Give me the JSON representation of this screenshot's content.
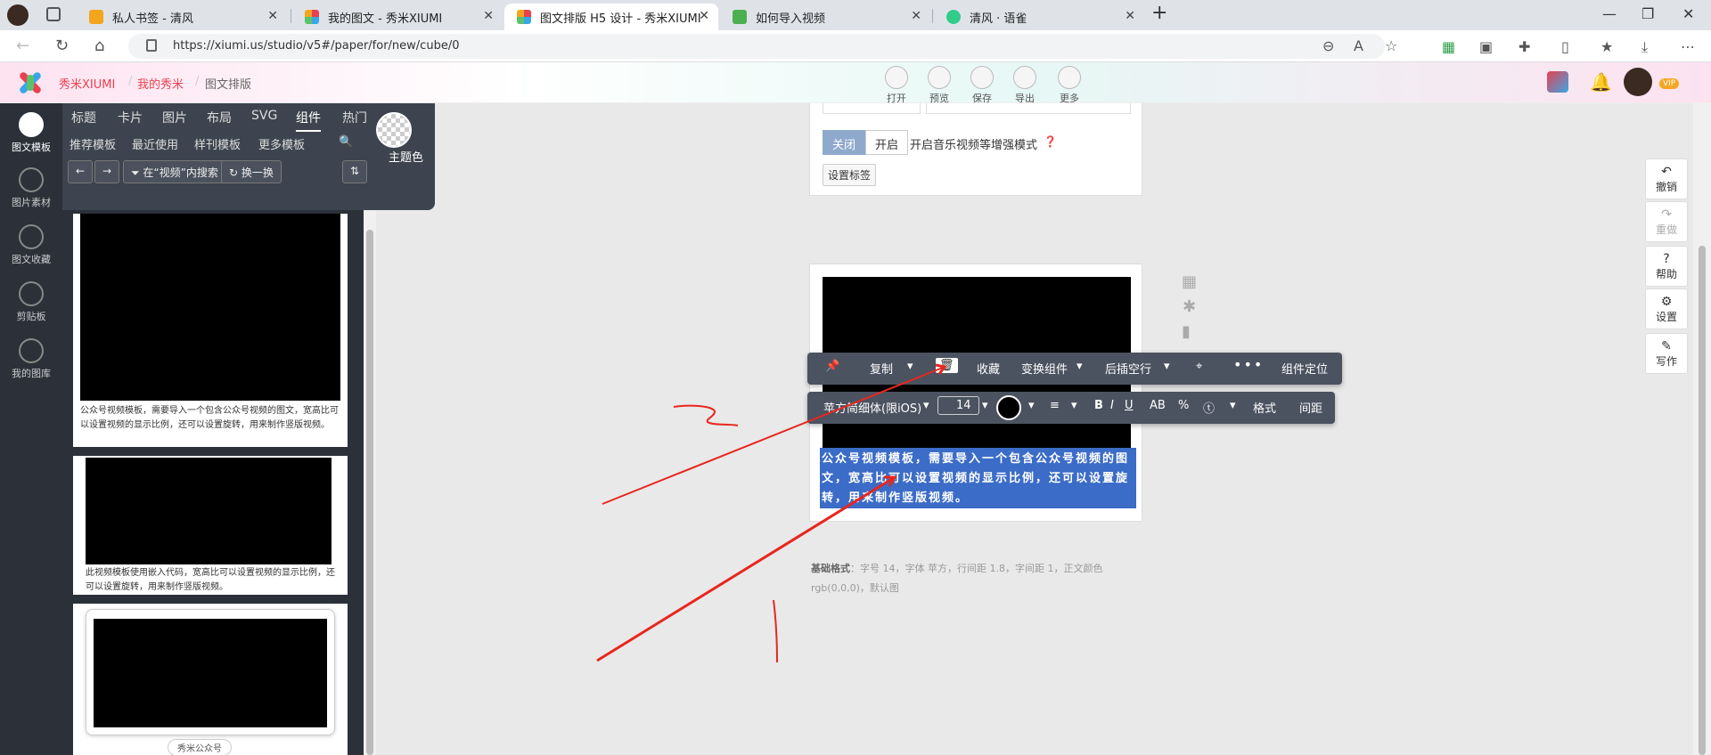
{
  "browser": {
    "tabs": [
      {
        "title": "私人书签 - 清风"
      },
      {
        "title": "我的图文 - 秀米XIUMI"
      },
      {
        "title": "图文排版 H5 设计 - 秀米XIUMI"
      },
      {
        "title": "如何导入视频"
      },
      {
        "title": "清风 · 语雀"
      }
    ],
    "url": "https://xiumi.us/studio/v5#/paper/for/new/cube/0"
  },
  "header": {
    "brand": "秀米XIUMI",
    "my": "我的秀米",
    "section": "图文排版",
    "tools": [
      "打开",
      "预览",
      "保存",
      "导出",
      "更多"
    ],
    "vip": "VIP"
  },
  "leftnav": {
    "items": [
      "图文模板",
      "图片素材",
      "图文收藏",
      "剪贴板",
      "我的图库"
    ]
  },
  "panel": {
    "tabs": [
      "标题",
      "卡片",
      "图片",
      "布局",
      "SVG",
      "组件",
      "热门"
    ],
    "subtabs": [
      "推荐模板",
      "最近使用",
      "样刊模板",
      "更多模板"
    ],
    "filter_label": "在“视频”内搜索",
    "shuffle_label": "换一换",
    "theme_label": "主题色"
  },
  "cards": [
    {
      "caption": "公众号视频模板，需要导入一个包含公众号视频的图文，宽高比可以设置视频的显示比例，还可以设置旋转，用来制作竖版视频。"
    },
    {
      "caption": "此视频模板使用嵌入代码，宽高比可以设置视频的显示比例，还可以设置旋转，用来制作竖版视频。"
    },
    {
      "caption": "秀米公众号"
    }
  ],
  "editor": {
    "toggle_off": "关闭",
    "toggle_on": "开启",
    "music_mode": "开启音乐视频等增强模式",
    "set_tag": "设置标签",
    "selected_text": "公众号视频模板，需要导入一个包含公众号视频的图文，宽高比可以设置视频的显示比例，还可以设置旋转，用来制作竖版视频。",
    "format_label": "基础格式",
    "format_text": "字号 14，字体 苹方，行间距 1.8，字间距 1，正文颜色 rgb(0,0,0)，默认图"
  },
  "toolbar1": {
    "copy": "复制",
    "collect": "收藏",
    "swap": "变换组件",
    "insert_after": "后插空行",
    "locate": "组件定位"
  },
  "toolbar2": {
    "font": "苹方简细体(限iOS)",
    "size": "14",
    "bold": "B",
    "italic": "I",
    "underline": "U",
    "ab": "AB",
    "percent": "%",
    "format": "格式",
    "spacing": "间距"
  },
  "sidebar_right": [
    {
      "label": "撤销"
    },
    {
      "label": "重做"
    },
    {
      "label": "帮助"
    },
    {
      "label": "设置"
    },
    {
      "label": "写作"
    }
  ],
  "colors": {
    "brand_red": "#e9414f",
    "selection": "#3b6cc7",
    "annotation": "#e8261e"
  }
}
